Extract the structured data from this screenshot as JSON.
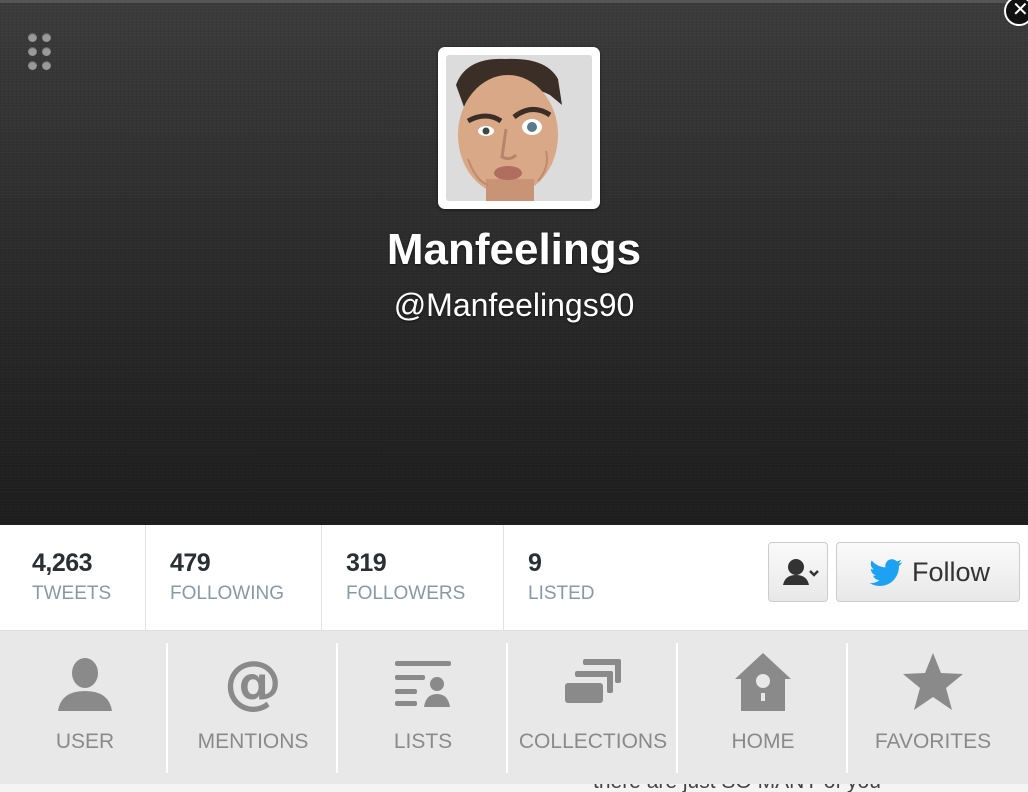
{
  "profile": {
    "name": "Manfeelings",
    "handle": "@Manfeelings90"
  },
  "stats": [
    {
      "value": "4,263",
      "label": "TWEETS"
    },
    {
      "value": "479",
      "label": "FOLLOWING"
    },
    {
      "value": "319",
      "label": "FOLLOWERS"
    },
    {
      "value": "9",
      "label": "LISTED"
    }
  ],
  "actions": {
    "follow_label": "Follow",
    "user_actions_icon": "person-dropdown-icon",
    "follow_icon": "twitter-bird-icon"
  },
  "nav": [
    {
      "label": "USER",
      "icon": "user-icon"
    },
    {
      "label": "MENTIONS",
      "icon": "at-icon"
    },
    {
      "label": "LISTS",
      "icon": "list-icon"
    },
    {
      "label": "COLLECTIONS",
      "icon": "collections-icon"
    },
    {
      "label": "HOME",
      "icon": "birdhouse-icon"
    },
    {
      "label": "FAVORITES",
      "icon": "star-icon"
    }
  ],
  "background_peek_text": "there are just SO MANY of you",
  "colors": {
    "twitter_blue": "#1da1f2",
    "icon_gray": "#8a8a8a",
    "stat_label": "#8899a6"
  }
}
